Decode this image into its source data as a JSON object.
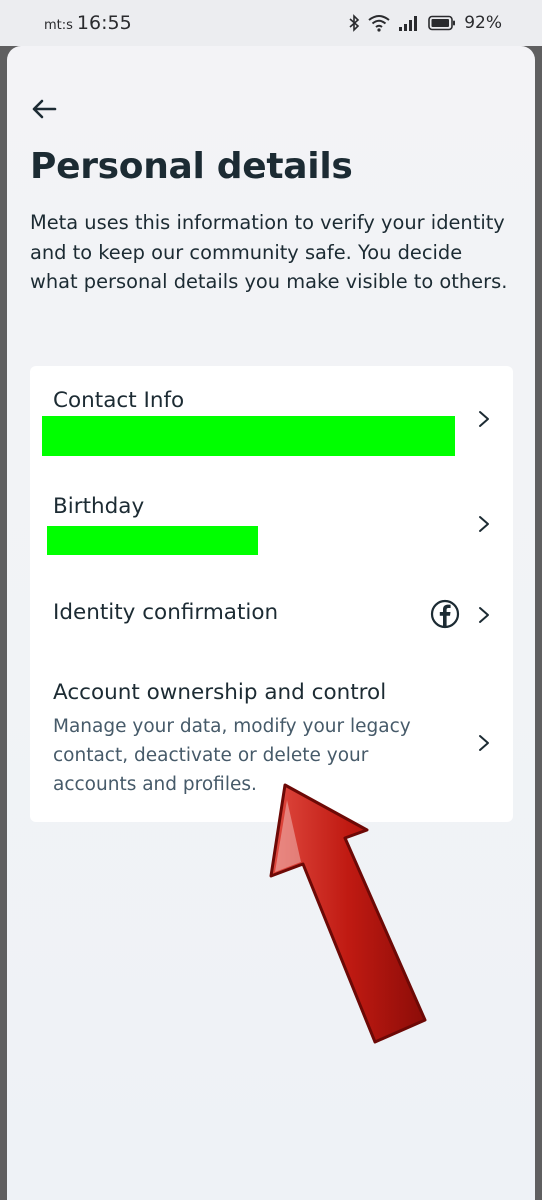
{
  "status_bar": {
    "carrier": "mt:s",
    "time": "16:55",
    "battery": "92%"
  },
  "page": {
    "title": "Personal details",
    "description": "Meta uses this information to verify your identity and to keep our community safe. You decide what personal details you make visible to others."
  },
  "rows": {
    "contact": {
      "title": "Contact Info"
    },
    "birthday": {
      "title": "Birthday"
    },
    "identity": {
      "title": "Identity confirmation"
    },
    "ownership": {
      "title": "Account ownership and control",
      "subtitle": "Manage your data, modify your legacy contact, deactivate or delete your accounts and profiles."
    }
  },
  "colors": {
    "redaction": "#00ff00",
    "arrow": "#b3130e",
    "text_primary": "#1c2b33",
    "text_secondary": "#465a69"
  },
  "icons": {
    "back": "arrow-left-icon",
    "chevron": "chevron-right-icon",
    "facebook": "facebook-icon",
    "bluetooth": "bluetooth-icon",
    "wifi": "wifi-icon",
    "signal": "signal-icon",
    "battery": "battery-icon"
  }
}
